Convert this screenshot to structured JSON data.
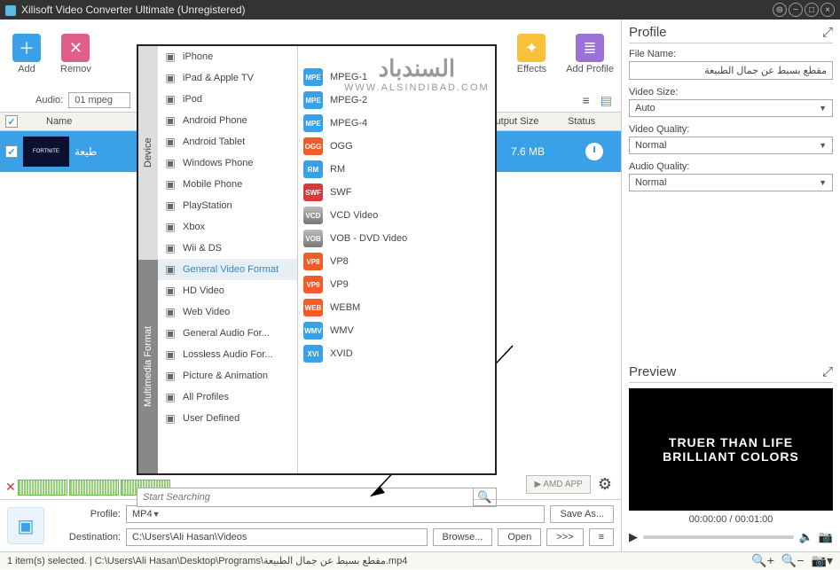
{
  "window": {
    "title": "Xilisoft Video Converter Ultimate (Unregistered)"
  },
  "toolbar": {
    "add": "Add",
    "remove": "Remov",
    "effects": "Effects",
    "add_profile": "Add Profile"
  },
  "audio_row": {
    "label": "Audio:",
    "value": "01 mpeg"
  },
  "list": {
    "headers": {
      "name": "Name",
      "output_size": "Output Size",
      "status": "Status"
    },
    "rows": [
      {
        "name": "طيعة",
        "size": "7.6 MB"
      }
    ]
  },
  "bottom": {
    "profile_label": "Profile:",
    "profile_value": "MP4",
    "dest_label": "Destination:",
    "dest_value": "C:\\Users\\Ali Hasan\\Videos",
    "browse": "Browse...",
    "save_as": "Save As...",
    "open": "Open",
    "more": ">>>"
  },
  "amd": "AMD APP",
  "statusbar": "1 item(s) selected. | C:\\Users\\Ali Hasan\\Desktop\\Programs\\مقطع بسيط عن جمال الطبيعة.mp4",
  "right": {
    "profile_title": "Profile",
    "filename_label": "File Name:",
    "filename_value": "مقطع بسيط عن جمال الطبيعة",
    "videosize_label": "Video Size:",
    "videosize_value": "Auto",
    "vq_label": "Video Quality:",
    "vq_value": "Normal",
    "aq_label": "Audio Quality:",
    "aq_value": "Normal",
    "preview_title": "Preview",
    "preview_line1": "TRUER THAN LIFE",
    "preview_line2": "BRILLIANT COLORS",
    "time": "00:00:00 / 00:01:00"
  },
  "dropdown": {
    "tabs": [
      "Device",
      "Multimedia Format"
    ],
    "col1": [
      "iPhone",
      "iPad & Apple TV",
      "iPod",
      "Android Phone",
      "Android Tablet",
      "Windows Phone",
      "Mobile Phone",
      "PlayStation",
      "Xbox",
      "Wii & DS",
      "General Video Format",
      "HD Video",
      "Web Video",
      "General Audio For...",
      "Lossless Audio For...",
      "Picture & Animation",
      "All Profiles",
      "User Defined"
    ],
    "col1_sel": 10,
    "col2": [
      {
        "l": "MPEG-1",
        "c": "b"
      },
      {
        "l": "MPEG-2",
        "c": "b"
      },
      {
        "l": "MPEG-4",
        "c": "b"
      },
      {
        "l": "OGG",
        "c": "o"
      },
      {
        "l": "RM",
        "c": "b"
      },
      {
        "l": "SWF",
        "c": "r"
      },
      {
        "l": "VCD Video",
        "c": "g"
      },
      {
        "l": "VOB - DVD Video",
        "c": "g"
      },
      {
        "l": "VP8",
        "c": "o"
      },
      {
        "l": "VP9",
        "c": "o"
      },
      {
        "l": "WEBM",
        "c": "o"
      },
      {
        "l": "WMV",
        "c": "b"
      },
      {
        "l": "XVID",
        "c": "b"
      }
    ],
    "search_placeholder": "Start Searching"
  },
  "watermark": {
    "ar": "السندباد",
    "en": "WWW.ALSINDIBAD.COM"
  }
}
